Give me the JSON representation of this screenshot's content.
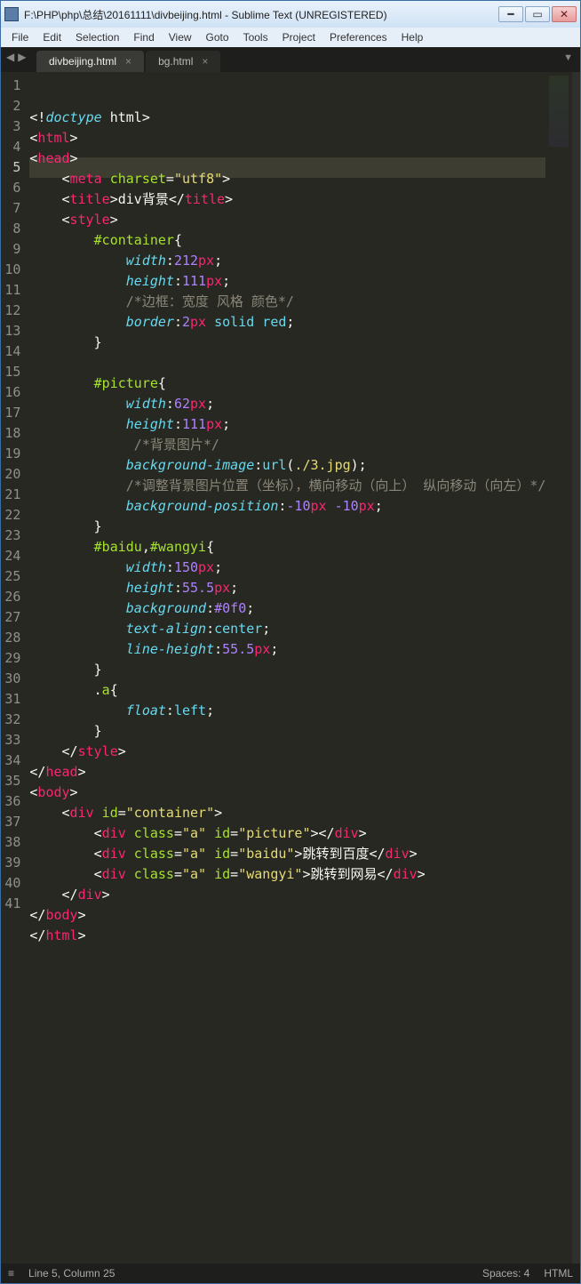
{
  "window": {
    "title": "F:\\PHP\\php\\总结\\20161111\\divbeijing.html - Sublime Text (UNREGISTERED)"
  },
  "menus": [
    "File",
    "Edit",
    "Selection",
    "Find",
    "View",
    "Goto",
    "Tools",
    "Project",
    "Preferences",
    "Help"
  ],
  "tabs": [
    {
      "label": "divbeijing.html",
      "active": true
    },
    {
      "label": "bg.html",
      "active": false
    }
  ],
  "gutter_line_numbers": [
    "1",
    "2",
    "3",
    "4",
    "5",
    "6",
    "7",
    "8",
    "9",
    "10",
    "11",
    "12",
    "13",
    "14",
    "15",
    "16",
    "17",
    "18",
    "19",
    "20",
    "21",
    "22",
    "23",
    "24",
    "25",
    "26",
    "27",
    "28",
    "29",
    "30",
    "31",
    "32",
    "33",
    "34",
    "35",
    "36",
    "37",
    "38",
    "39",
    "40",
    "41"
  ],
  "current_line_index": 4,
  "code_tokens": [
    [
      {
        "t": "<!",
        "c": "c-bracket"
      },
      {
        "t": "doctype",
        "c": "c-doctype"
      },
      {
        "t": " html",
        "c": "c-text"
      },
      {
        "t": ">",
        "c": "c-bracket"
      }
    ],
    [
      {
        "t": "<",
        "c": "c-bracket"
      },
      {
        "t": "html",
        "c": "c-tag"
      },
      {
        "t": ">",
        "c": "c-bracket"
      }
    ],
    [
      {
        "t": "<",
        "c": "c-bracket"
      },
      {
        "t": "head",
        "c": "c-tag"
      },
      {
        "t": ">",
        "c": "c-bracket"
      }
    ],
    [
      {
        "t": "    ",
        "c": "c-text"
      },
      {
        "t": "<",
        "c": "c-bracket"
      },
      {
        "t": "meta",
        "c": "c-tag"
      },
      {
        "t": " ",
        "c": "c-text"
      },
      {
        "t": "charset",
        "c": "c-attr"
      },
      {
        "t": "=",
        "c": "c-punc"
      },
      {
        "t": "\"utf8\"",
        "c": "c-string"
      },
      {
        "t": ">",
        "c": "c-bracket"
      }
    ],
    [
      {
        "t": "    ",
        "c": "c-text"
      },
      {
        "t": "<",
        "c": "c-bracket"
      },
      {
        "t": "title",
        "c": "c-tag"
      },
      {
        "t": ">",
        "c": "c-bracket"
      },
      {
        "t": "div背景",
        "c": "c-text"
      },
      {
        "t": "</",
        "c": "c-bracket"
      },
      {
        "t": "title",
        "c": "c-tag"
      },
      {
        "t": ">",
        "c": "c-bracket"
      }
    ],
    [
      {
        "t": "    ",
        "c": "c-text"
      },
      {
        "t": "<",
        "c": "c-bracket"
      },
      {
        "t": "style",
        "c": "c-tag"
      },
      {
        "t": ">",
        "c": "c-bracket"
      }
    ],
    [
      {
        "t": "        ",
        "c": "c-text"
      },
      {
        "t": "#container",
        "c": "c-sel"
      },
      {
        "t": "{",
        "c": "c-punc"
      }
    ],
    [
      {
        "t": "            ",
        "c": "c-text"
      },
      {
        "t": "width",
        "c": "c-prop"
      },
      {
        "t": ":",
        "c": "c-punc"
      },
      {
        "t": "212",
        "c": "c-num"
      },
      {
        "t": "px",
        "c": "c-unit"
      },
      {
        "t": ";",
        "c": "c-punc"
      }
    ],
    [
      {
        "t": "            ",
        "c": "c-text"
      },
      {
        "t": "height",
        "c": "c-prop"
      },
      {
        "t": ":",
        "c": "c-punc"
      },
      {
        "t": "111",
        "c": "c-num"
      },
      {
        "t": "px",
        "c": "c-unit"
      },
      {
        "t": ";",
        "c": "c-punc"
      }
    ],
    [
      {
        "t": "            ",
        "c": "c-text"
      },
      {
        "t": "/*边框：宽度 风格 颜色*/",
        "c": "c-comment"
      }
    ],
    [
      {
        "t": "            ",
        "c": "c-text"
      },
      {
        "t": "border",
        "c": "c-prop"
      },
      {
        "t": ":",
        "c": "c-punc"
      },
      {
        "t": "2",
        "c": "c-num"
      },
      {
        "t": "px",
        "c": "c-unit"
      },
      {
        "t": " ",
        "c": "c-text"
      },
      {
        "t": "solid",
        "c": "c-val"
      },
      {
        "t": " ",
        "c": "c-text"
      },
      {
        "t": "red",
        "c": "c-val"
      },
      {
        "t": ";",
        "c": "c-punc"
      }
    ],
    [
      {
        "t": "        ",
        "c": "c-text"
      },
      {
        "t": "}",
        "c": "c-punc"
      }
    ],
    [],
    [
      {
        "t": "        ",
        "c": "c-text"
      },
      {
        "t": "#picture",
        "c": "c-sel"
      },
      {
        "t": "{",
        "c": "c-punc"
      }
    ],
    [
      {
        "t": "            ",
        "c": "c-text"
      },
      {
        "t": "width",
        "c": "c-prop"
      },
      {
        "t": ":",
        "c": "c-punc"
      },
      {
        "t": "62",
        "c": "c-num"
      },
      {
        "t": "px",
        "c": "c-unit"
      },
      {
        "t": ";",
        "c": "c-punc"
      }
    ],
    [
      {
        "t": "            ",
        "c": "c-text"
      },
      {
        "t": "height",
        "c": "c-prop"
      },
      {
        "t": ":",
        "c": "c-punc"
      },
      {
        "t": "111",
        "c": "c-num"
      },
      {
        "t": "px",
        "c": "c-unit"
      },
      {
        "t": ";",
        "c": "c-punc"
      }
    ],
    [
      {
        "t": "            ",
        "c": "c-text"
      },
      {
        "t": " /*背景图片*/",
        "c": "c-comment"
      }
    ],
    [
      {
        "t": "            ",
        "c": "c-text"
      },
      {
        "t": "background-image",
        "c": "c-prop"
      },
      {
        "t": ":",
        "c": "c-punc"
      },
      {
        "t": "url",
        "c": "c-func"
      },
      {
        "t": "(",
        "c": "c-punc"
      },
      {
        "t": "./3.jpg",
        "c": "c-string"
      },
      {
        "t": ")",
        "c": "c-punc"
      },
      {
        "t": ";",
        "c": "c-punc"
      }
    ],
    [
      {
        "t": "            ",
        "c": "c-text"
      },
      {
        "t": "/*调整背景图片位置（坐标），横向移动（向上） 纵向移动（向左）*/",
        "c": "c-comment"
      }
    ],
    [
      {
        "t": "            ",
        "c": "c-text"
      },
      {
        "t": "background-position",
        "c": "c-prop"
      },
      {
        "t": ":",
        "c": "c-punc"
      },
      {
        "t": "-10",
        "c": "c-num"
      },
      {
        "t": "px",
        "c": "c-unit"
      },
      {
        "t": " ",
        "c": "c-text"
      },
      {
        "t": "-10",
        "c": "c-num"
      },
      {
        "t": "px",
        "c": "c-unit"
      },
      {
        "t": ";",
        "c": "c-punc"
      }
    ],
    [
      {
        "t": "        ",
        "c": "c-text"
      },
      {
        "t": "}",
        "c": "c-punc"
      }
    ],
    [
      {
        "t": "        ",
        "c": "c-text"
      },
      {
        "t": "#baidu",
        "c": "c-sel"
      },
      {
        "t": ",",
        "c": "c-punc"
      },
      {
        "t": "#wangyi",
        "c": "c-sel"
      },
      {
        "t": "{",
        "c": "c-punc"
      }
    ],
    [
      {
        "t": "            ",
        "c": "c-text"
      },
      {
        "t": "width",
        "c": "c-prop"
      },
      {
        "t": ":",
        "c": "c-punc"
      },
      {
        "t": "150",
        "c": "c-num"
      },
      {
        "t": "px",
        "c": "c-unit"
      },
      {
        "t": ";",
        "c": "c-punc"
      }
    ],
    [
      {
        "t": "            ",
        "c": "c-text"
      },
      {
        "t": "height",
        "c": "c-prop"
      },
      {
        "t": ":",
        "c": "c-punc"
      },
      {
        "t": "55.5",
        "c": "c-num"
      },
      {
        "t": "px",
        "c": "c-unit"
      },
      {
        "t": ";",
        "c": "c-punc"
      }
    ],
    [
      {
        "t": "            ",
        "c": "c-text"
      },
      {
        "t": "background",
        "c": "c-prop"
      },
      {
        "t": ":",
        "c": "c-punc"
      },
      {
        "t": "#0f0",
        "c": "c-num"
      },
      {
        "t": ";",
        "c": "c-punc"
      }
    ],
    [
      {
        "t": "            ",
        "c": "c-text"
      },
      {
        "t": "text-align",
        "c": "c-prop"
      },
      {
        "t": ":",
        "c": "c-punc"
      },
      {
        "t": "center",
        "c": "c-val"
      },
      {
        "t": ";",
        "c": "c-punc"
      }
    ],
    [
      {
        "t": "            ",
        "c": "c-text"
      },
      {
        "t": "line-height",
        "c": "c-prop"
      },
      {
        "t": ":",
        "c": "c-punc"
      },
      {
        "t": "55.5",
        "c": "c-num"
      },
      {
        "t": "px",
        "c": "c-unit"
      },
      {
        "t": ";",
        "c": "c-punc"
      }
    ],
    [
      {
        "t": "        ",
        "c": "c-text"
      },
      {
        "t": "}",
        "c": "c-punc"
      }
    ],
    [
      {
        "t": "        ",
        "c": "c-text"
      },
      {
        "t": ".",
        "c": "c-punc"
      },
      {
        "t": "a",
        "c": "c-sel"
      },
      {
        "t": "{",
        "c": "c-punc"
      }
    ],
    [
      {
        "t": "            ",
        "c": "c-text"
      },
      {
        "t": "float",
        "c": "c-prop"
      },
      {
        "t": ":",
        "c": "c-punc"
      },
      {
        "t": "left",
        "c": "c-val"
      },
      {
        "t": ";",
        "c": "c-punc"
      }
    ],
    [
      {
        "t": "        ",
        "c": "c-text"
      },
      {
        "t": "}",
        "c": "c-punc"
      }
    ],
    [
      {
        "t": "    ",
        "c": "c-text"
      },
      {
        "t": "</",
        "c": "c-bracket"
      },
      {
        "t": "style",
        "c": "c-tag"
      },
      {
        "t": ">",
        "c": "c-bracket"
      }
    ],
    [
      {
        "t": "</",
        "c": "c-bracket"
      },
      {
        "t": "head",
        "c": "c-tag"
      },
      {
        "t": ">",
        "c": "c-bracket"
      }
    ],
    [
      {
        "t": "<",
        "c": "c-bracket"
      },
      {
        "t": "body",
        "c": "c-tag"
      },
      {
        "t": ">",
        "c": "c-bracket"
      }
    ],
    [
      {
        "t": "    ",
        "c": "c-text"
      },
      {
        "t": "<",
        "c": "c-bracket"
      },
      {
        "t": "div",
        "c": "c-tag"
      },
      {
        "t": " ",
        "c": "c-text"
      },
      {
        "t": "id",
        "c": "c-attr"
      },
      {
        "t": "=",
        "c": "c-punc"
      },
      {
        "t": "\"container\"",
        "c": "c-string"
      },
      {
        "t": ">",
        "c": "c-bracket"
      }
    ],
    [
      {
        "t": "        ",
        "c": "c-text"
      },
      {
        "t": "<",
        "c": "c-bracket"
      },
      {
        "t": "div",
        "c": "c-tag"
      },
      {
        "t": " ",
        "c": "c-text"
      },
      {
        "t": "class",
        "c": "c-attr"
      },
      {
        "t": "=",
        "c": "c-punc"
      },
      {
        "t": "\"a\"",
        "c": "c-string"
      },
      {
        "t": " ",
        "c": "c-text"
      },
      {
        "t": "id",
        "c": "c-attr"
      },
      {
        "t": "=",
        "c": "c-punc"
      },
      {
        "t": "\"picture\"",
        "c": "c-string"
      },
      {
        "t": "></",
        "c": "c-bracket"
      },
      {
        "t": "div",
        "c": "c-tag"
      },
      {
        "t": ">",
        "c": "c-bracket"
      }
    ],
    [
      {
        "t": "        ",
        "c": "c-text"
      },
      {
        "t": "<",
        "c": "c-bracket"
      },
      {
        "t": "div",
        "c": "c-tag"
      },
      {
        "t": " ",
        "c": "c-text"
      },
      {
        "t": "class",
        "c": "c-attr"
      },
      {
        "t": "=",
        "c": "c-punc"
      },
      {
        "t": "\"a\"",
        "c": "c-string"
      },
      {
        "t": " ",
        "c": "c-text"
      },
      {
        "t": "id",
        "c": "c-attr"
      },
      {
        "t": "=",
        "c": "c-punc"
      },
      {
        "t": "\"baidu\"",
        "c": "c-string"
      },
      {
        "t": ">",
        "c": "c-bracket"
      },
      {
        "t": "跳转到百度",
        "c": "c-text"
      },
      {
        "t": "</",
        "c": "c-bracket"
      },
      {
        "t": "div",
        "c": "c-tag"
      },
      {
        "t": ">",
        "c": "c-bracket"
      }
    ],
    [
      {
        "t": "        ",
        "c": "c-text"
      },
      {
        "t": "<",
        "c": "c-bracket"
      },
      {
        "t": "div",
        "c": "c-tag"
      },
      {
        "t": " ",
        "c": "c-text"
      },
      {
        "t": "class",
        "c": "c-attr"
      },
      {
        "t": "=",
        "c": "c-punc"
      },
      {
        "t": "\"a\"",
        "c": "c-string"
      },
      {
        "t": " ",
        "c": "c-text"
      },
      {
        "t": "id",
        "c": "c-attr"
      },
      {
        "t": "=",
        "c": "c-punc"
      },
      {
        "t": "\"wangyi\"",
        "c": "c-string"
      },
      {
        "t": ">",
        "c": "c-bracket"
      },
      {
        "t": "跳转到网易",
        "c": "c-text"
      },
      {
        "t": "</",
        "c": "c-bracket"
      },
      {
        "t": "div",
        "c": "c-tag"
      },
      {
        "t": ">",
        "c": "c-bracket"
      }
    ],
    [
      {
        "t": "    ",
        "c": "c-text"
      },
      {
        "t": "</",
        "c": "c-bracket"
      },
      {
        "t": "div",
        "c": "c-tag"
      },
      {
        "t": ">",
        "c": "c-bracket"
      }
    ],
    [
      {
        "t": "</",
        "c": "c-bracket"
      },
      {
        "t": "body",
        "c": "c-tag"
      },
      {
        "t": ">",
        "c": "c-bracket"
      }
    ],
    [
      {
        "t": "</",
        "c": "c-bracket"
      },
      {
        "t": "html",
        "c": "c-tag"
      },
      {
        "t": ">",
        "c": "c-bracket"
      }
    ]
  ],
  "status": {
    "position": "Line 5, Column 25",
    "indent": "Spaces: 4",
    "syntax": "HTML"
  }
}
